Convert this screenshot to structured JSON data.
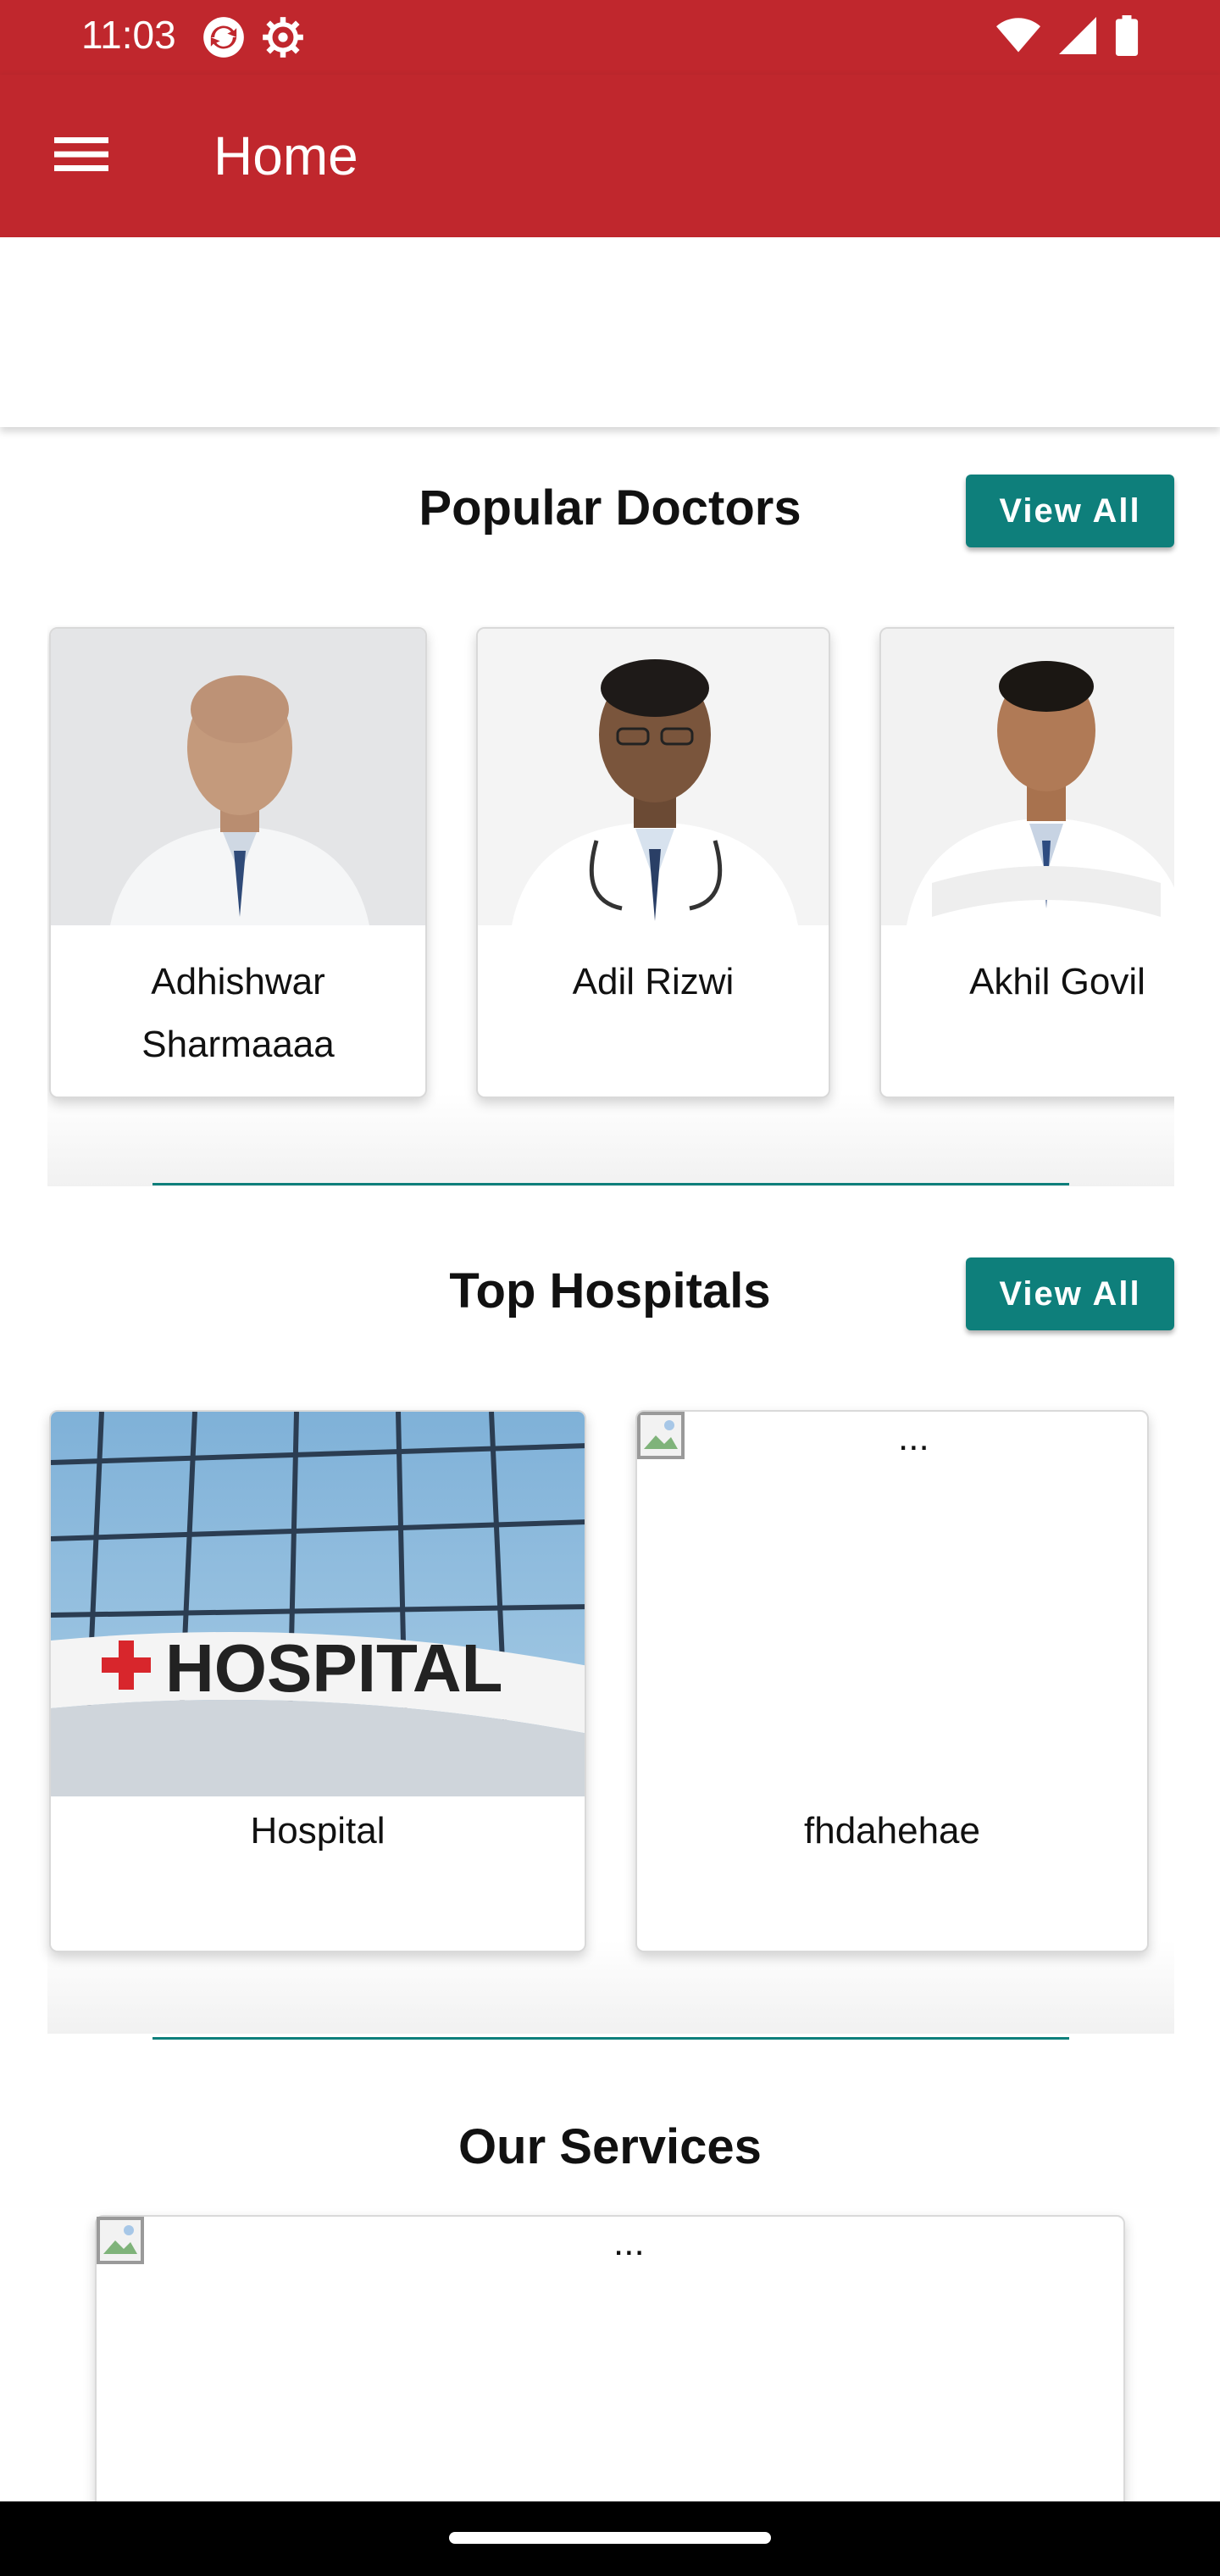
{
  "status_bar": {
    "time": "11:03",
    "left_icons": [
      "sync-icon",
      "settings-icon"
    ],
    "right_icons": [
      "wifi-icon",
      "signal-icon",
      "battery-icon"
    ]
  },
  "app_bar": {
    "title": "Home",
    "menu_icon": "menu-icon"
  },
  "popular_doctors": {
    "title": "Popular Doctors",
    "view_all": "View All",
    "items": [
      {
        "name": "Adhishwar Sharmaaaa"
      },
      {
        "name": "Adil Rizwi"
      },
      {
        "name": "Akhil Govil"
      }
    ]
  },
  "top_hospitals": {
    "title": "Top Hospitals",
    "view_all": "View All",
    "items": [
      {
        "name": "Hospital",
        "image_text": "HOSPITAL"
      },
      {
        "name": "fhdahehae",
        "image_alt": "..."
      }
    ]
  },
  "our_services": {
    "title": "Our Services",
    "items": [
      {
        "image_alt": "..."
      }
    ]
  },
  "colors": {
    "primary": "#c0272d",
    "accent": "#0e7f7b"
  }
}
